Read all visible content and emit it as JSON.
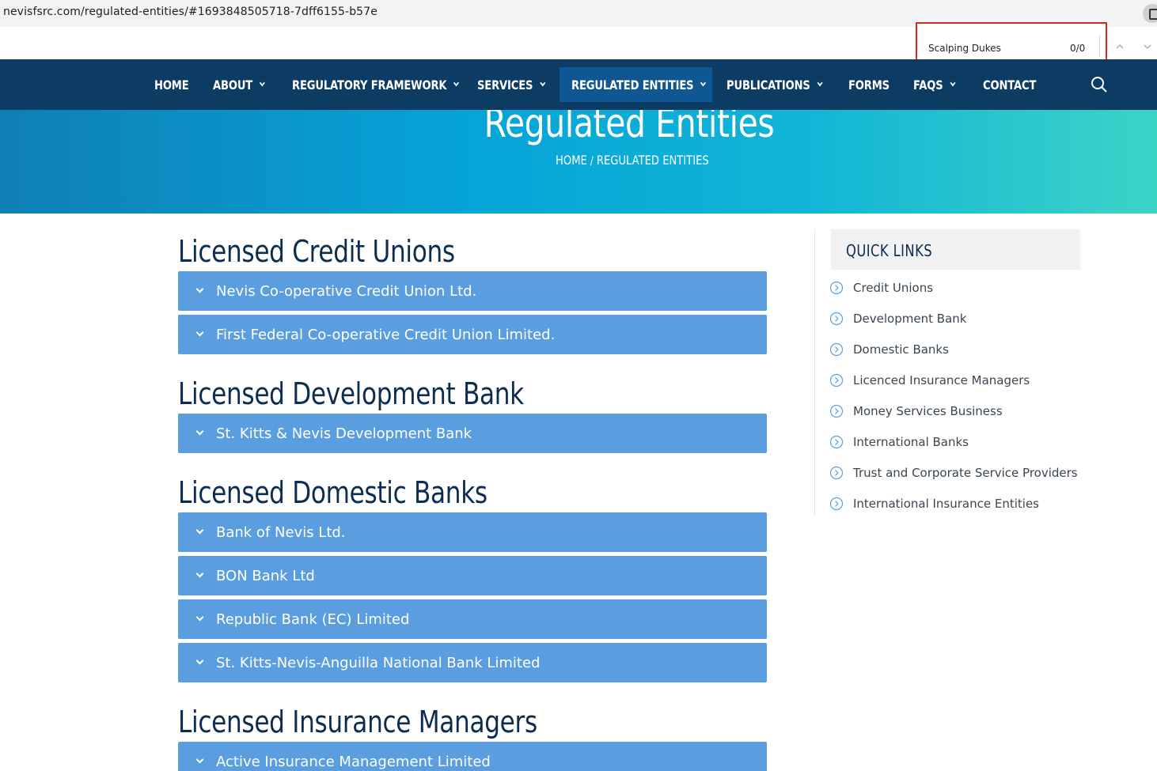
{
  "browser": {
    "url": "nevisfsrc.com/regulated-entities/#1693848505718-7dff6155-b57e"
  },
  "find": {
    "query": "Scalping Dukes",
    "count": "0/0"
  },
  "nav": {
    "items": [
      {
        "label": "HOME",
        "dropdown": false
      },
      {
        "label": "ABOUT",
        "dropdown": true
      },
      {
        "label": "REGULATORY FRAMEWORK",
        "dropdown": true
      },
      {
        "label": "SERVICES",
        "dropdown": true
      },
      {
        "label": "REGULATED ENTITIES",
        "dropdown": true,
        "active": true
      },
      {
        "label": "PUBLICATIONS",
        "dropdown": true
      },
      {
        "label": "FORMS",
        "dropdown": false
      },
      {
        "label": "FAQS",
        "dropdown": true
      },
      {
        "label": "CONTACT",
        "dropdown": false
      }
    ]
  },
  "hero": {
    "title": "Regulated Entities",
    "breadcrumb_home": "HOME",
    "breadcrumb_sep": "/",
    "breadcrumb_current": "REGULATED ENTITIES"
  },
  "sections": [
    {
      "title": "Licensed Credit Unions",
      "items": [
        "Nevis Co-operative Credit Union Ltd.",
        "First Federal Co-operative Credit Union Limited."
      ]
    },
    {
      "title": "Licensed Development Bank",
      "items": [
        "St. Kitts & Nevis Development Bank"
      ]
    },
    {
      "title": "Licensed Domestic Banks",
      "items": [
        "Bank of Nevis Ltd.",
        "BON Bank Ltd",
        "Republic Bank (EC) Limited",
        "St. Kitts-Nevis-Anguilla National Bank Limited"
      ]
    },
    {
      "title": "Licensed Insurance Managers",
      "items": [
        "Active Insurance Management Limited"
      ]
    }
  ],
  "quick_links": {
    "title": "QUICK LINKS",
    "items": [
      "Credit Unions",
      "Development Bank",
      "Domestic Banks",
      "Licenced Insurance Managers",
      "Money Services Business",
      "International Banks",
      "Trust and Corporate Service Providers",
      "International Insurance Entities"
    ]
  },
  "colors": {
    "nav_bg": "#0c3b64",
    "nav_active": "#0f5793",
    "accordion": "#5b9ee0",
    "heading": "#0c2d4f",
    "find_highlight": "#e0231c"
  }
}
